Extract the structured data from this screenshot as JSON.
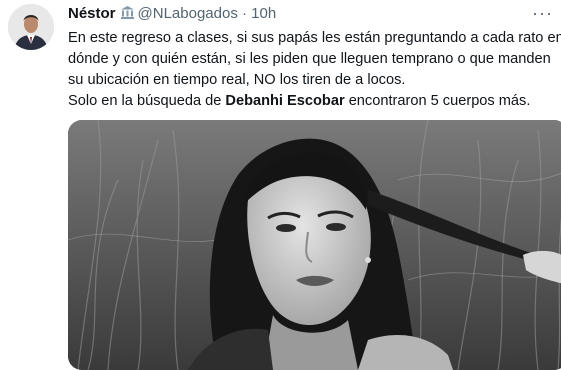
{
  "tweet": {
    "author_name": "Néstor",
    "handle": "@NLabogados",
    "separator": "·",
    "timestamp": "10h",
    "more_glyph": "···",
    "verified_icon": "government-building-icon",
    "lines": [
      "En este regreso a clases, si sus papás les están preguntando a cada rato en",
      "dónde y con quién están, si les piden que lleguen temprano o que manden",
      "su ubicación en tiempo real, NO los tiren de a locos."
    ],
    "last_line": {
      "before": "Solo en la búsqueda de ",
      "bold": "Debanhi Escobar",
      "after": " encontraron 5 cuerpos más."
    }
  },
  "colors": {
    "text": "#0f1419",
    "secondary": "#536471",
    "background": "#ffffff"
  }
}
